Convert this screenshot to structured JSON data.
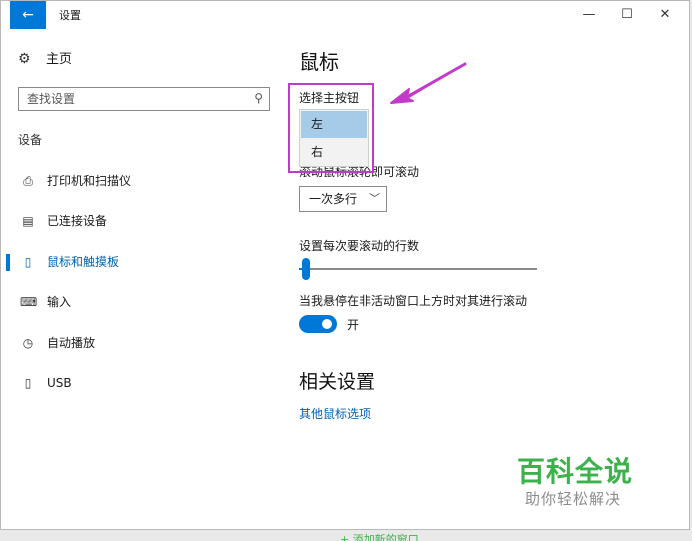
{
  "window": {
    "title": "设置",
    "back_icon": "←",
    "min_icon": "—",
    "max_icon": "☐",
    "close_icon": "✕"
  },
  "sidebar": {
    "home": {
      "icon": "⚙",
      "label": "主页"
    },
    "search": {
      "placeholder": "查找设置",
      "icon": "⚲"
    },
    "section": "设备",
    "items": [
      {
        "icon": "⎙",
        "label": "打印机和扫描仪",
        "active": false
      },
      {
        "icon": "▤",
        "label": "已连接设备",
        "active": false
      },
      {
        "icon": "▯",
        "label": "鼠标和触摸板",
        "active": true
      },
      {
        "icon": "⌨",
        "label": "输入",
        "active": false
      },
      {
        "icon": "◷",
        "label": "自动播放",
        "active": false
      },
      {
        "icon": "▯",
        "label": "USB",
        "active": false
      }
    ]
  },
  "main": {
    "title": "鼠标",
    "primary_button": {
      "label": "选择主按钮",
      "options": [
        "左",
        "右"
      ],
      "selected": "左"
    },
    "scroll_label": "滚动鼠标滚轮即可滚动",
    "scroll_select": {
      "value": "一次多行",
      "chevron": "﹀"
    },
    "lines_label": "设置每次要滚动的行数",
    "lines_slider_fraction": 0.03,
    "inactive_scroll_label": "当我悬停在非活动窗口上方时对其进行滚动",
    "inactive_scroll_toggle": {
      "state": "开"
    },
    "related_title": "相关设置",
    "related_link": "其他鼠标选项"
  },
  "watermark": {
    "main": "百科全说",
    "sub": "助你轻松解决",
    "bottom_text": "+ 添加新的窗口"
  },
  "colors": {
    "accent": "#0078d7",
    "highlight": "#c23ac9",
    "watermark_green": "#3db14b"
  }
}
